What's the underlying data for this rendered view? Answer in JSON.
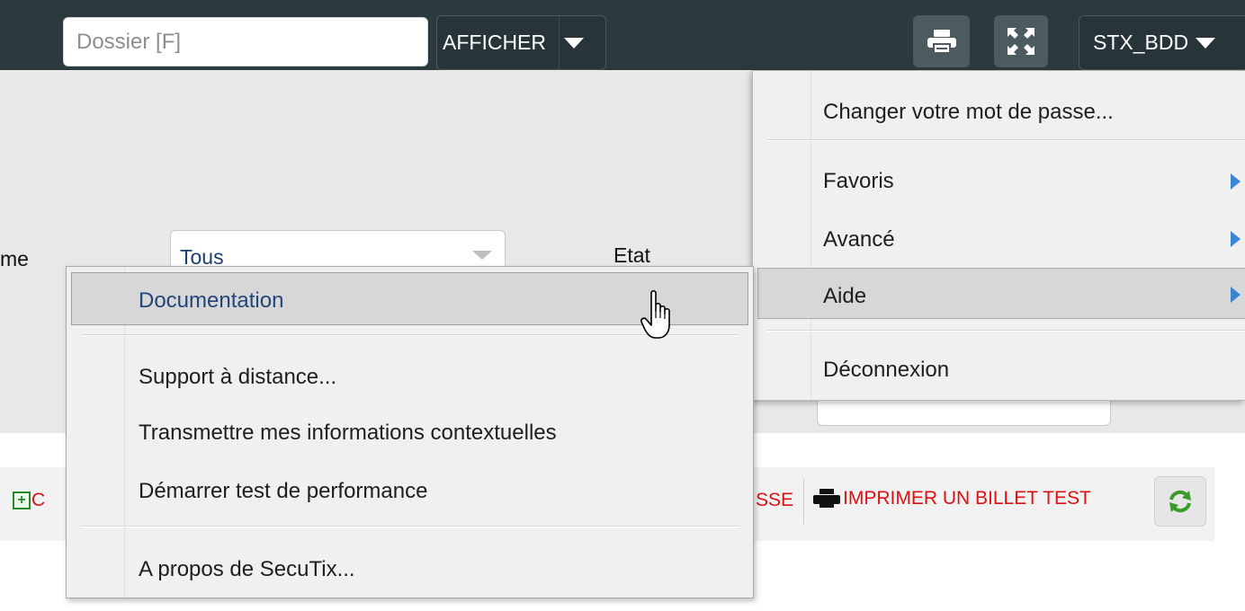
{
  "topbar": {
    "search_placeholder": "Dossier [F]",
    "afficher_label": "AFFICHER",
    "print_icon": "printer-icon",
    "fullscreen_icon": "fullscreen-icon",
    "user_label": "STX_BDD",
    "background_color": "#2c3a3f"
  },
  "filters": {
    "left_label_fragment": "me",
    "select_value": "Tous",
    "etat_label": "Etat"
  },
  "toolbar": {
    "add_label_fragment": "C",
    "partial_label": "SSE",
    "print_test_label": "IMPRIMER UN BILLET TEST",
    "refresh_icon": "refresh-icon",
    "label_color": "#dd1111"
  },
  "user_menu": {
    "change_password": "Changer votre mot de passe...",
    "favoris": "Favoris",
    "avance": "Avancé",
    "aide": "Aide",
    "deconnexion": "Déconnexion",
    "submenu_arrow_color": "#3a86d4"
  },
  "help_menu": {
    "documentation": "Documentation",
    "support": "Support à distance...",
    "transmettre": "Transmettre mes informations contextuelles",
    "performance": "Démarrer test de performance",
    "a_propos": "A propos de SecuTix..."
  }
}
